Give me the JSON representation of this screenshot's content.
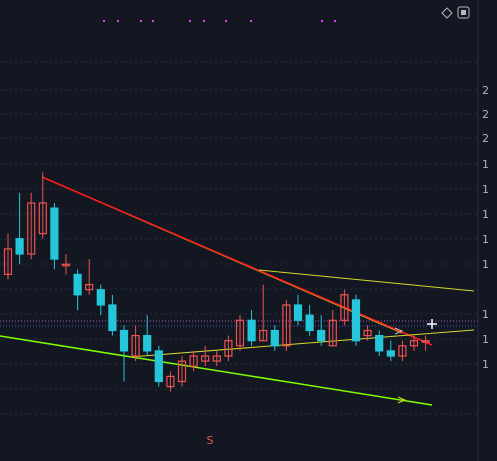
{
  "toolbar": {
    "icons": [
      "diamond-icon",
      "square-icon"
    ]
  },
  "chart_data": {
    "type": "candlestick",
    "title": "",
    "ylabel": "",
    "xlabel": "",
    "y_axis_tick_labels": [
      "2",
      "2",
      "2",
      "1",
      "1",
      "1",
      "1",
      "1",
      "1",
      "1",
      "1"
    ],
    "bottom_marker_label": "S",
    "colors": {
      "up": "#ef5350",
      "down": "#26c6da",
      "background": "#131722",
      "grid": "#2a2e39",
      "downtrend_line": "#ff1a1a",
      "trend_yellow": "#d4d82a",
      "support_green": "#7fff00",
      "horizontal_blue": "#3f51b5",
      "horizontal_purple": "#b05cc2",
      "signal_marker": "#e040fb"
    },
    "candles": [
      {
        "o": 0.56,
        "c": 0.61,
        "h": 0.64,
        "l": 0.55
      },
      {
        "o": 0.63,
        "c": 0.6,
        "h": 0.72,
        "l": 0.58
      },
      {
        "o": 0.6,
        "c": 0.7,
        "h": 0.72,
        "l": 0.59
      },
      {
        "o": 0.64,
        "c": 0.7,
        "h": 0.76,
        "l": 0.63
      },
      {
        "o": 0.69,
        "c": 0.59,
        "h": 0.7,
        "l": 0.57
      },
      {
        "o": 0.58,
        "c": 0.58,
        "h": 0.6,
        "l": 0.56
      },
      {
        "o": 0.56,
        "c": 0.52,
        "h": 0.57,
        "l": 0.49
      },
      {
        "o": 0.53,
        "c": 0.54,
        "h": 0.59,
        "l": 0.52
      },
      {
        "o": 0.53,
        "c": 0.5,
        "h": 0.54,
        "l": 0.48
      },
      {
        "o": 0.5,
        "c": 0.45,
        "h": 0.52,
        "l": 0.44
      },
      {
        "o": 0.45,
        "c": 0.41,
        "h": 0.46,
        "l": 0.35
      },
      {
        "o": 0.4,
        "c": 0.44,
        "h": 0.46,
        "l": 0.39
      },
      {
        "o": 0.44,
        "c": 0.41,
        "h": 0.48,
        "l": 0.4
      },
      {
        "o": 0.41,
        "c": 0.35,
        "h": 0.42,
        "l": 0.34
      },
      {
        "o": 0.34,
        "c": 0.36,
        "h": 0.37,
        "l": 0.33
      },
      {
        "o": 0.35,
        "c": 0.39,
        "h": 0.4,
        "l": 0.34
      },
      {
        "o": 0.38,
        "c": 0.4,
        "h": 0.41,
        "l": 0.37
      },
      {
        "o": 0.39,
        "c": 0.4,
        "h": 0.42,
        "l": 0.38
      },
      {
        "o": 0.39,
        "c": 0.4,
        "h": 0.41,
        "l": 0.38
      },
      {
        "o": 0.4,
        "c": 0.43,
        "h": 0.44,
        "l": 0.39
      },
      {
        "o": 0.42,
        "c": 0.47,
        "h": 0.48,
        "l": 0.41
      },
      {
        "o": 0.47,
        "c": 0.43,
        "h": 0.49,
        "l": 0.42
      },
      {
        "o": 0.43,
        "c": 0.45,
        "h": 0.54,
        "l": 0.43
      },
      {
        "o": 0.45,
        "c": 0.42,
        "h": 0.46,
        "l": 0.41
      },
      {
        "o": 0.42,
        "c": 0.5,
        "h": 0.51,
        "l": 0.41
      },
      {
        "o": 0.5,
        "c": 0.47,
        "h": 0.52,
        "l": 0.46
      },
      {
        "o": 0.48,
        "c": 0.45,
        "h": 0.5,
        "l": 0.44
      },
      {
        "o": 0.45,
        "c": 0.43,
        "h": 0.48,
        "l": 0.42
      },
      {
        "o": 0.42,
        "c": 0.47,
        "h": 0.49,
        "l": 0.42
      },
      {
        "o": 0.47,
        "c": 0.52,
        "h": 0.53,
        "l": 0.46
      },
      {
        "o": 0.51,
        "c": 0.43,
        "h": 0.52,
        "l": 0.42
      },
      {
        "o": 0.44,
        "c": 0.45,
        "h": 0.46,
        "l": 0.43
      },
      {
        "o": 0.44,
        "c": 0.41,
        "h": 0.45,
        "l": 0.4
      },
      {
        "o": 0.41,
        "c": 0.4,
        "h": 0.43,
        "l": 0.39
      },
      {
        "o": 0.4,
        "c": 0.42,
        "h": 0.43,
        "l": 0.39
      },
      {
        "o": 0.42,
        "c": 0.43,
        "h": 0.44,
        "l": 0.41
      },
      {
        "o": 0.43,
        "c": 0.43,
        "h": 0.44,
        "l": 0.41
      }
    ]
  }
}
